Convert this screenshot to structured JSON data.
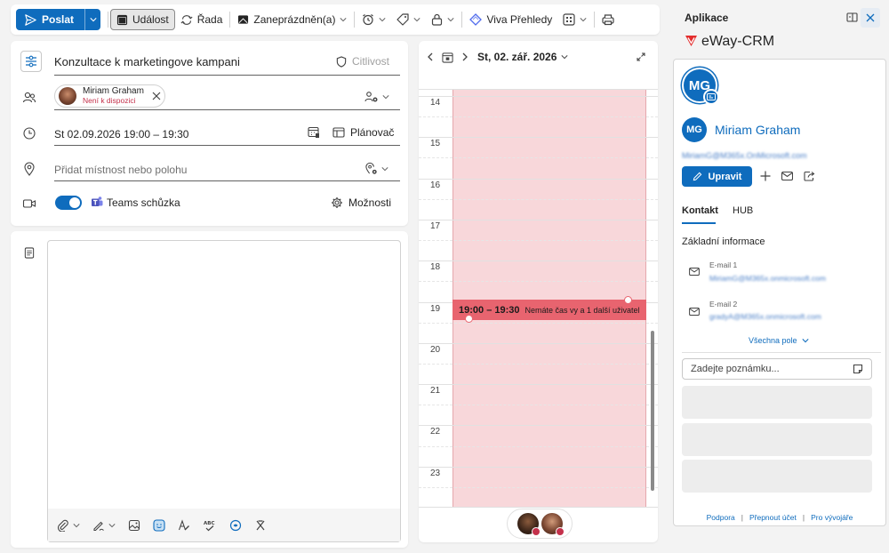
{
  "toolbar": {
    "send_label": "Poslat",
    "event_label": "Událost",
    "series_label": "Řada",
    "busy_label": "Zaneprázdněn(a)",
    "viva_label": "Viva Přehledy",
    "icons": [
      "send-icon",
      "calendar-icon",
      "repeat-icon",
      "busy-status-icon",
      "reminder-clock-icon",
      "tag-icon",
      "lock-icon",
      "viva-icon",
      "apps-grid-icon",
      "print-icon"
    ]
  },
  "form": {
    "title": "Konzultace k marketingove kampani",
    "sensitivity_label": "Citlivost",
    "attendee": {
      "name": "Miriam Graham",
      "status": "Není k dispozici"
    },
    "datetime": "St 02.09.2026 19:00 – 19:30",
    "scheduler_label": "Plánovač",
    "location_placeholder": "Přidat místnost nebo polohu",
    "teams_label": "Teams schůzka",
    "teams_enabled": true,
    "options_label": "Možnosti"
  },
  "editor": {
    "tools": [
      "attach-icon",
      "signature-icon",
      "image-icon",
      "sticker-icon",
      "editor-icon",
      "spellcheck-icon",
      "copilot-icon",
      "clear-format-icon"
    ]
  },
  "calendar": {
    "date_label": "St, 02. zář. 2026",
    "hours": [
      "14",
      "15",
      "16",
      "17",
      "18",
      "19",
      "20",
      "21",
      "22",
      "23"
    ],
    "event": {
      "time": "19:00 – 19:30",
      "text": "Nemáte čas vy a 1 další uživatel"
    }
  },
  "sidebar": {
    "header_title": "Aplikace",
    "app_name": "eWay-CRM",
    "initials": "MG",
    "contact_name": "Miriam Graham",
    "contact_email": "MiriamG@M365x.OnMicrosoft.com",
    "edit_label": "Upravit",
    "tabs": [
      "Kontakt",
      "HUB"
    ],
    "section_title": "Základní informace",
    "fields": [
      {
        "label": "E-mail 1",
        "value": "MiriamG@M365x.onmicrosoft.com"
      },
      {
        "label": "E-mail 2",
        "value": "gradyA@M365x.onmicrosoft.com"
      }
    ],
    "all_fields_label": "Všechna pole",
    "note_placeholder": "Zadejte poznámku...",
    "footer": [
      "Podpora",
      "Přepnout účet",
      "Pro vývojáře"
    ]
  },
  "colors": {
    "accent": "#0f6cbd",
    "busy_fill": "#f8d7da",
    "event": "#e8646f",
    "crm_red": "#e32d2d"
  }
}
